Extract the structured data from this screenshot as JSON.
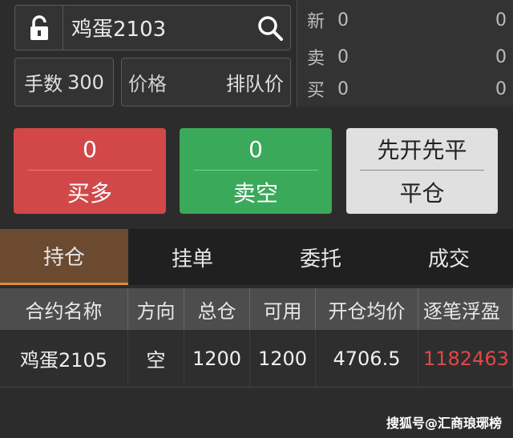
{
  "order": {
    "contract_name": "鸡蛋2103",
    "qty_label": "手数",
    "qty_value": "300",
    "price_label": "价格",
    "price_mode": "排队价"
  },
  "quote": [
    {
      "label": "新",
      "value": "0",
      "right": "0"
    },
    {
      "label": "卖",
      "value": "0",
      "right": "0"
    },
    {
      "label": "买",
      "value": "0",
      "right": "0"
    }
  ],
  "actions": {
    "buy_long": {
      "count": "0",
      "label": "买多"
    },
    "sell_short": {
      "count": "0",
      "label": "卖空"
    },
    "close": {
      "mode": "先开先平",
      "label": "平仓"
    }
  },
  "tabs": [
    "持仓",
    "挂单",
    "委托",
    "成交"
  ],
  "table": {
    "headers": [
      "合约名称",
      "方向",
      "总仓",
      "可用",
      "开仓均价",
      "逐笔浮盈"
    ],
    "rows": [
      [
        "鸡蛋2105",
        "空",
        "1200",
        "1200",
        "4706.5",
        "1182463"
      ]
    ]
  },
  "watermark": "搜狐号@汇商琅琊榜",
  "colors": {
    "buy": "#d24849",
    "sell": "#3aa95a",
    "active_tab": "#6b4a30",
    "profit": "#e04848"
  }
}
